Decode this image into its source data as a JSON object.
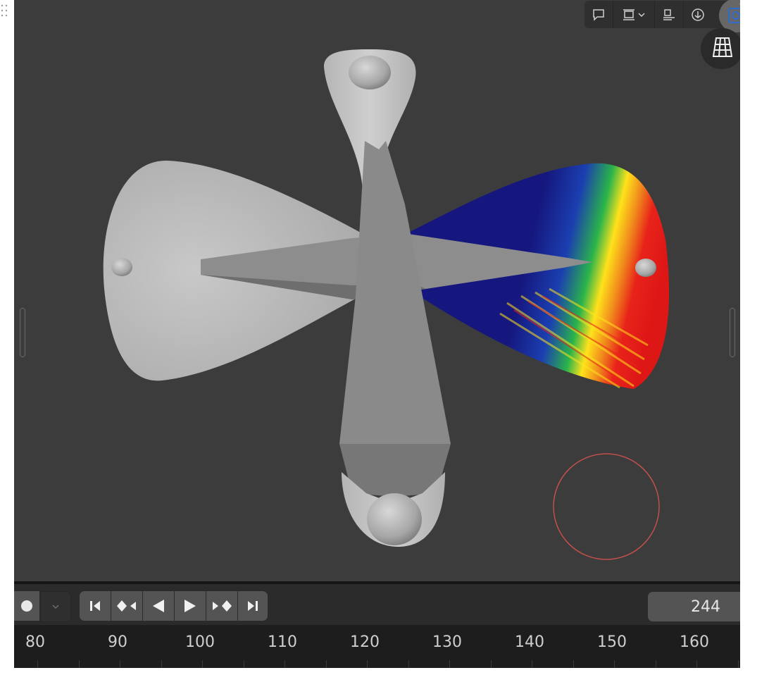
{
  "viewport": {
    "background": "#3c3c3c",
    "header_buttons": [
      "speech-bubble-icon",
      "snap-icon",
      "chevron-down-icon",
      "align-icon",
      "download-icon"
    ],
    "nav_gizmo": [
      "camera-view-icon",
      "grid-view-icon"
    ],
    "selection_circle_color": "#d9534f"
  },
  "timeline": {
    "controls": [
      "record-icon",
      "chevron-down-icon",
      "jump-start-icon",
      "prev-keyframe-icon",
      "play-reverse-icon",
      "play-icon",
      "next-keyframe-icon",
      "jump-end-icon"
    ],
    "current_frame": "244"
  },
  "ruler": {
    "ticks": [
      "80",
      "90",
      "100",
      "110",
      "120",
      "130",
      "140",
      "150",
      "160"
    ]
  },
  "colors": {
    "heatmap": [
      "#15177e",
      "#1a2aa0",
      "#2ab44a",
      "#ffe21b",
      "#f08a1c",
      "#e8231a",
      "#dd1616"
    ]
  }
}
